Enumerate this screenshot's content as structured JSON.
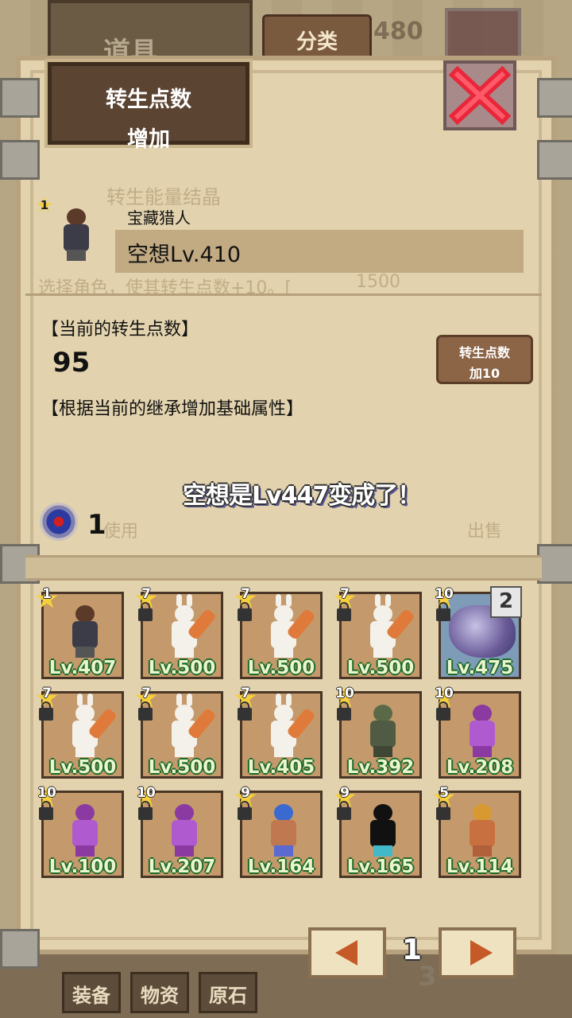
{
  "background": {
    "tab_label": "道具",
    "classify_label": "分类",
    "count_text": "480",
    "faded_item_name": "转生能量结晶",
    "faded_desc": "选择角色，使其转生点数+10。[",
    "faded_price": "1500",
    "faded_use": "使用",
    "faded_sell": "出售",
    "bottom_tabs": [
      "装备",
      "物资",
      "原石"
    ],
    "bottom_page": "3"
  },
  "dialog": {
    "title_line1": "转生点数",
    "title_line2": "增加",
    "character": {
      "star_rank": "1",
      "class_name": "宝藏猎人",
      "name_level": "空想Lv.410"
    },
    "current_points_label": "【当前的转生点数】",
    "current_points_value": "95",
    "inherit_label": "【根据当前的继承增加基础属性】",
    "add_button": {
      "line1": "转生点数",
      "line2": "加10"
    },
    "notice": "空想是Lv447变成了！",
    "crystal_count": "1"
  },
  "roster": [
    {
      "rank": "1",
      "level": "Lv.407",
      "type": "hunter",
      "locked": false
    },
    {
      "rank": "7",
      "level": "Lv.500",
      "type": "rabbit",
      "locked": true
    },
    {
      "rank": "7",
      "level": "Lv.500",
      "type": "rabbit",
      "locked": true
    },
    {
      "rank": "7",
      "level": "Lv.500",
      "type": "rabbit",
      "locked": true
    },
    {
      "rank": "10",
      "level": "Lv.475",
      "type": "beast",
      "locked": true,
      "count": "2"
    },
    {
      "rank": "7",
      "level": "Lv.500",
      "type": "rabbit",
      "locked": true
    },
    {
      "rank": "7",
      "level": "Lv.500",
      "type": "rabbit",
      "locked": true
    },
    {
      "rank": "7",
      "level": "Lv.405",
      "type": "rabbit",
      "locked": true
    },
    {
      "rank": "10",
      "level": "Lv.392",
      "type": "zombie",
      "locked": true
    },
    {
      "rank": "10",
      "level": "Lv.208",
      "type": "ninja",
      "locked": true
    },
    {
      "rank": "10",
      "level": "Lv.100",
      "type": "ninja",
      "locked": true
    },
    {
      "rank": "10",
      "level": "Lv.207",
      "type": "ninja",
      "locked": true
    },
    {
      "rank": "9",
      "level": "Lv.164",
      "type": "pirate",
      "locked": true
    },
    {
      "rank": "9",
      "level": "Lv.165",
      "type": "shadow",
      "locked": true
    },
    {
      "rank": "5",
      "level": "Lv.114",
      "type": "viking",
      "locked": true
    }
  ],
  "pager": {
    "page": "1",
    "prev_icon": "arrow-left-icon",
    "next_icon": "arrow-right-icon"
  },
  "colors": {
    "accent": "#c55a28",
    "level_text": "#eaf5ce",
    "level_outline": "#1c6a28",
    "star": "#f5cf3c",
    "close_red": "#e8283a"
  }
}
